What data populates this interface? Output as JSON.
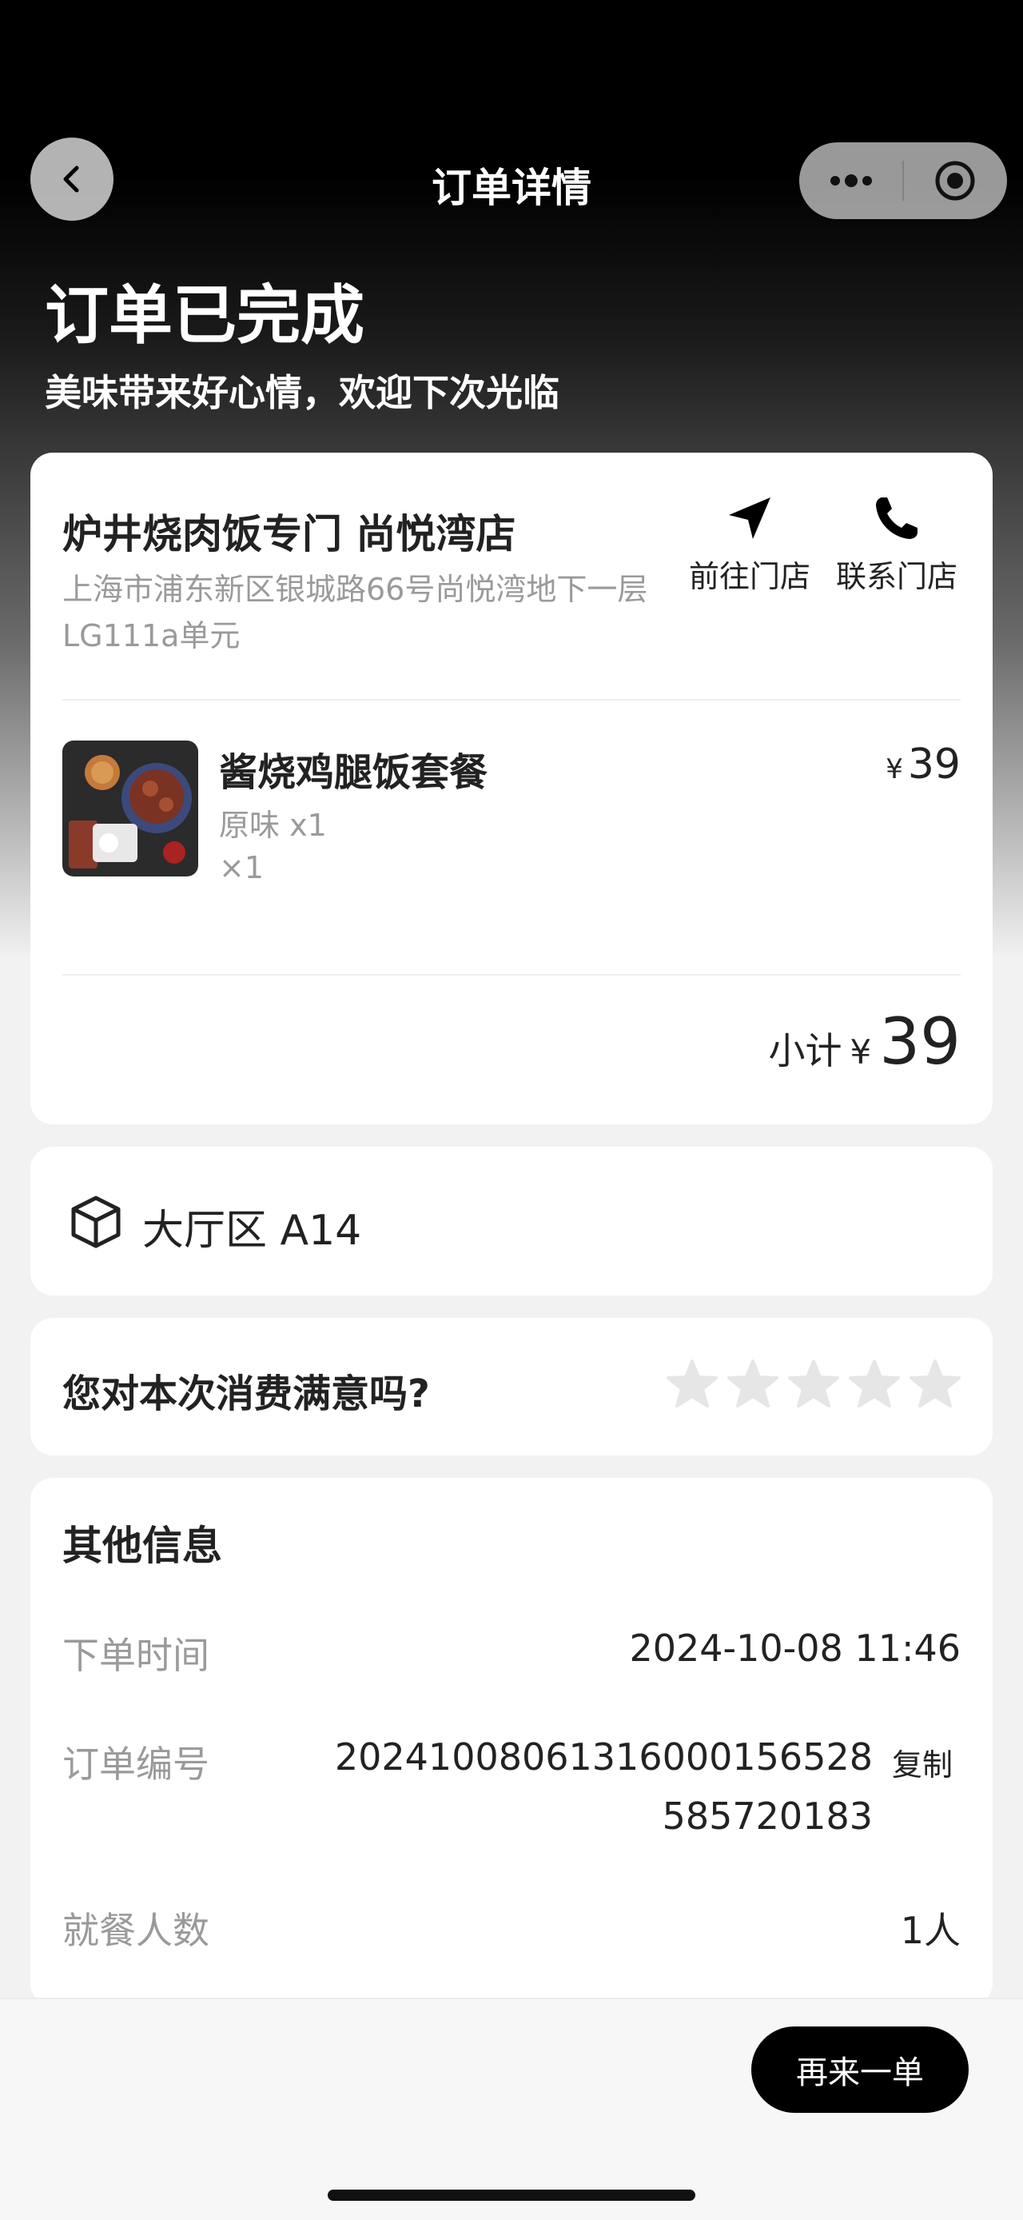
{
  "nav": {
    "title": "订单详情"
  },
  "status": {
    "title": "订单已完成",
    "subtitle": "美味带来好心情，欢迎下次光临"
  },
  "store": {
    "name": "炉井烧肉饭专门 尚悦湾店",
    "address": "上海市浦东新区银城路66号尚悦湾地下一层LG111a单元",
    "navigate_label": "前往门店",
    "call_label": "联系门店"
  },
  "item": {
    "name": "酱烧鸡腿饭套餐",
    "spec": "原味 x1",
    "qty": "×1",
    "currency": "¥",
    "price": "39"
  },
  "subtotal": {
    "label": "小计",
    "currency": "¥",
    "amount": "39"
  },
  "seat": {
    "text": "大厅区 A14"
  },
  "rating": {
    "question": "您对本次消费满意吗?",
    "stars": 5,
    "selected": 0
  },
  "info": {
    "title": "其他信息",
    "order_time_label": "下单时间",
    "order_time_value": "2024-10-08 11:46",
    "order_no_label": "订单编号",
    "order_no_line1": "2024100806131600015652​8",
    "order_no_line2": "585720183",
    "copy_label": "复制",
    "diners_label": "就餐人数",
    "diners_value": "1人"
  },
  "actions": {
    "reorder_label": "再来一单"
  }
}
